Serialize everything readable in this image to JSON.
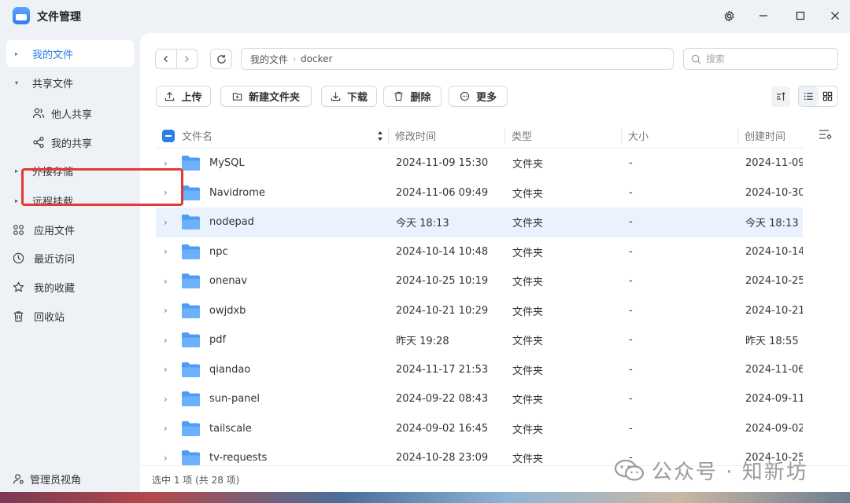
{
  "app": {
    "title": "文件管理"
  },
  "titlebar": {
    "settings_icon": "gear-icon",
    "min_icon": "minimize-icon",
    "max_icon": "maximize-icon",
    "close_icon": "close-icon"
  },
  "sidebar": {
    "items": [
      {
        "label": "我的文件",
        "icon": "caret-right",
        "active": true
      },
      {
        "label": "共享文件",
        "icon": "caret-down"
      },
      {
        "label": "他人共享",
        "icon": "users-icon"
      },
      {
        "label": "我的共享",
        "icon": "share-icon"
      },
      {
        "label": "外接存储",
        "icon": "caret-right"
      },
      {
        "label": "远程挂载",
        "icon": "caret-right"
      },
      {
        "label": "应用文件",
        "icon": "apps-icon"
      },
      {
        "label": "最近访问",
        "icon": "clock-icon"
      },
      {
        "label": "我的收藏",
        "icon": "star-icon"
      },
      {
        "label": "回收站",
        "icon": "trash-icon"
      }
    ],
    "bottom": {
      "label": "管理员视角",
      "icon": "admin-icon"
    }
  },
  "path": {
    "root": "我的文件",
    "current": "docker"
  },
  "search": {
    "placeholder": "搜索",
    "value": ""
  },
  "toolbar": {
    "upload": "上传",
    "new_folder": "新建文件夹",
    "download": "下载",
    "delete": "删除",
    "more": "更多"
  },
  "table": {
    "headers": {
      "name": "文件名",
      "mtime": "修改时间",
      "type": "类型",
      "size": "大小",
      "ctime": "创建时间"
    },
    "rows": [
      {
        "name": "MySQL",
        "mtime": "2024-11-09 15:30",
        "type": "文件夹",
        "size": "-",
        "ctime": "2024-11-09"
      },
      {
        "name": "Navidrome",
        "mtime": "2024-11-06 09:49",
        "type": "文件夹",
        "size": "-",
        "ctime": "2024-10-30"
      },
      {
        "name": "nodepad",
        "mtime": "今天 18:13",
        "type": "文件夹",
        "size": "-",
        "ctime": "今天 18:13",
        "selected": true
      },
      {
        "name": "npc",
        "mtime": "2024-10-14 10:48",
        "type": "文件夹",
        "size": "-",
        "ctime": "2024-10-14"
      },
      {
        "name": "onenav",
        "mtime": "2024-10-25 10:19",
        "type": "文件夹",
        "size": "-",
        "ctime": "2024-10-25"
      },
      {
        "name": "owjdxb",
        "mtime": "2024-10-21 10:29",
        "type": "文件夹",
        "size": "-",
        "ctime": "2024-10-21"
      },
      {
        "name": "pdf",
        "mtime": "昨天 19:28",
        "type": "文件夹",
        "size": "-",
        "ctime": "昨天 18:55"
      },
      {
        "name": "qiandao",
        "mtime": "2024-11-17 21:53",
        "type": "文件夹",
        "size": "-",
        "ctime": "2024-11-06"
      },
      {
        "name": "sun-panel",
        "mtime": "2024-09-22 08:43",
        "type": "文件夹",
        "size": "-",
        "ctime": "2024-09-11"
      },
      {
        "name": "tailscale",
        "mtime": "2024-09-02 16:45",
        "type": "文件夹",
        "size": "-",
        "ctime": "2024-09-02"
      },
      {
        "name": "tv-requests",
        "mtime": "2024-10-28 23:09",
        "type": "文件夹",
        "size": "-",
        "ctime": "2024-10-25"
      }
    ]
  },
  "status": {
    "text": "选中 1 项 (共 28 项)"
  },
  "watermark": {
    "text": "公众号 · 知新坊"
  },
  "colors": {
    "accent": "#2b7de9",
    "folder": "#5aa7ff",
    "highlight": "#e53935",
    "selected_row": "#e9f2fd"
  }
}
